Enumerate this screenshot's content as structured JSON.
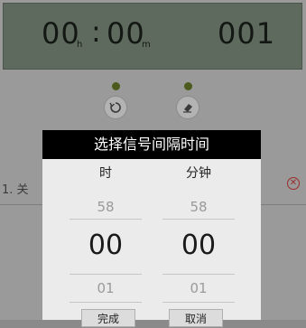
{
  "timer": {
    "hours": "00",
    "hours_unit": "h",
    "minutes": "00",
    "minutes_unit": "m",
    "count": "001"
  },
  "list": {
    "item_text": "1. 关"
  },
  "dialog": {
    "title": "选择信号间隔时间",
    "hour_column": {
      "label": "时",
      "prev": "58",
      "value": "00",
      "next": "01"
    },
    "minute_column": {
      "label": "分钟",
      "prev": "58",
      "value": "00",
      "next": "01"
    },
    "confirm_label": "完成",
    "cancel_label": "取消"
  },
  "colors": {
    "display_bg": "#5e6a5e",
    "indicator_dot": "#4d5a1e",
    "delete_icon": "#9b2d2d"
  }
}
